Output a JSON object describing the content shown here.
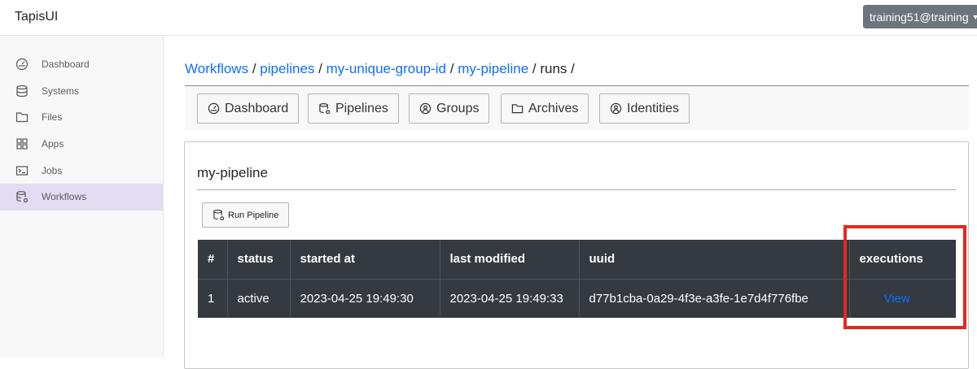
{
  "app": {
    "title": "TapisUI",
    "user": "training51@training"
  },
  "sidebar": {
    "items": [
      {
        "label": "Dashboard",
        "icon": "dashboard-icon"
      },
      {
        "label": "Systems",
        "icon": "database-icon"
      },
      {
        "label": "Files",
        "icon": "folder-icon"
      },
      {
        "label": "Apps",
        "icon": "apps-grid-icon"
      },
      {
        "label": "Jobs",
        "icon": "terminal-icon"
      },
      {
        "label": "Workflows",
        "icon": "workflow-icon",
        "active": true
      }
    ]
  },
  "breadcrumb": {
    "items": [
      "Workflows",
      "pipelines",
      "my-unique-group-id",
      "my-pipeline"
    ],
    "current": "runs",
    "separator": "/"
  },
  "workflow_nav": {
    "buttons": [
      "Dashboard",
      "Pipelines",
      "Groups",
      "Archives",
      "Identities"
    ]
  },
  "pipeline": {
    "title": "my-pipeline",
    "run_button": "Run Pipeline",
    "table": {
      "headers": [
        "#",
        "status",
        "started at",
        "last modified",
        "uuid",
        "executions"
      ],
      "rows": [
        {
          "num": "1",
          "status": "active",
          "started_at": "2023-04-25 19:49:30",
          "last_modified": "2023-04-25 19:49:33",
          "uuid": "d77b1cba-0a29-4f3e-a3fe-1e7d4f776fbe",
          "executions": "View"
        }
      ]
    }
  },
  "colors": {
    "active_sidebar_bg": "#e4dcf3",
    "link": "#0d6efd",
    "table_bg": "#343a40",
    "highlight": "#e8271b",
    "user_button_bg": "#6c757d"
  }
}
